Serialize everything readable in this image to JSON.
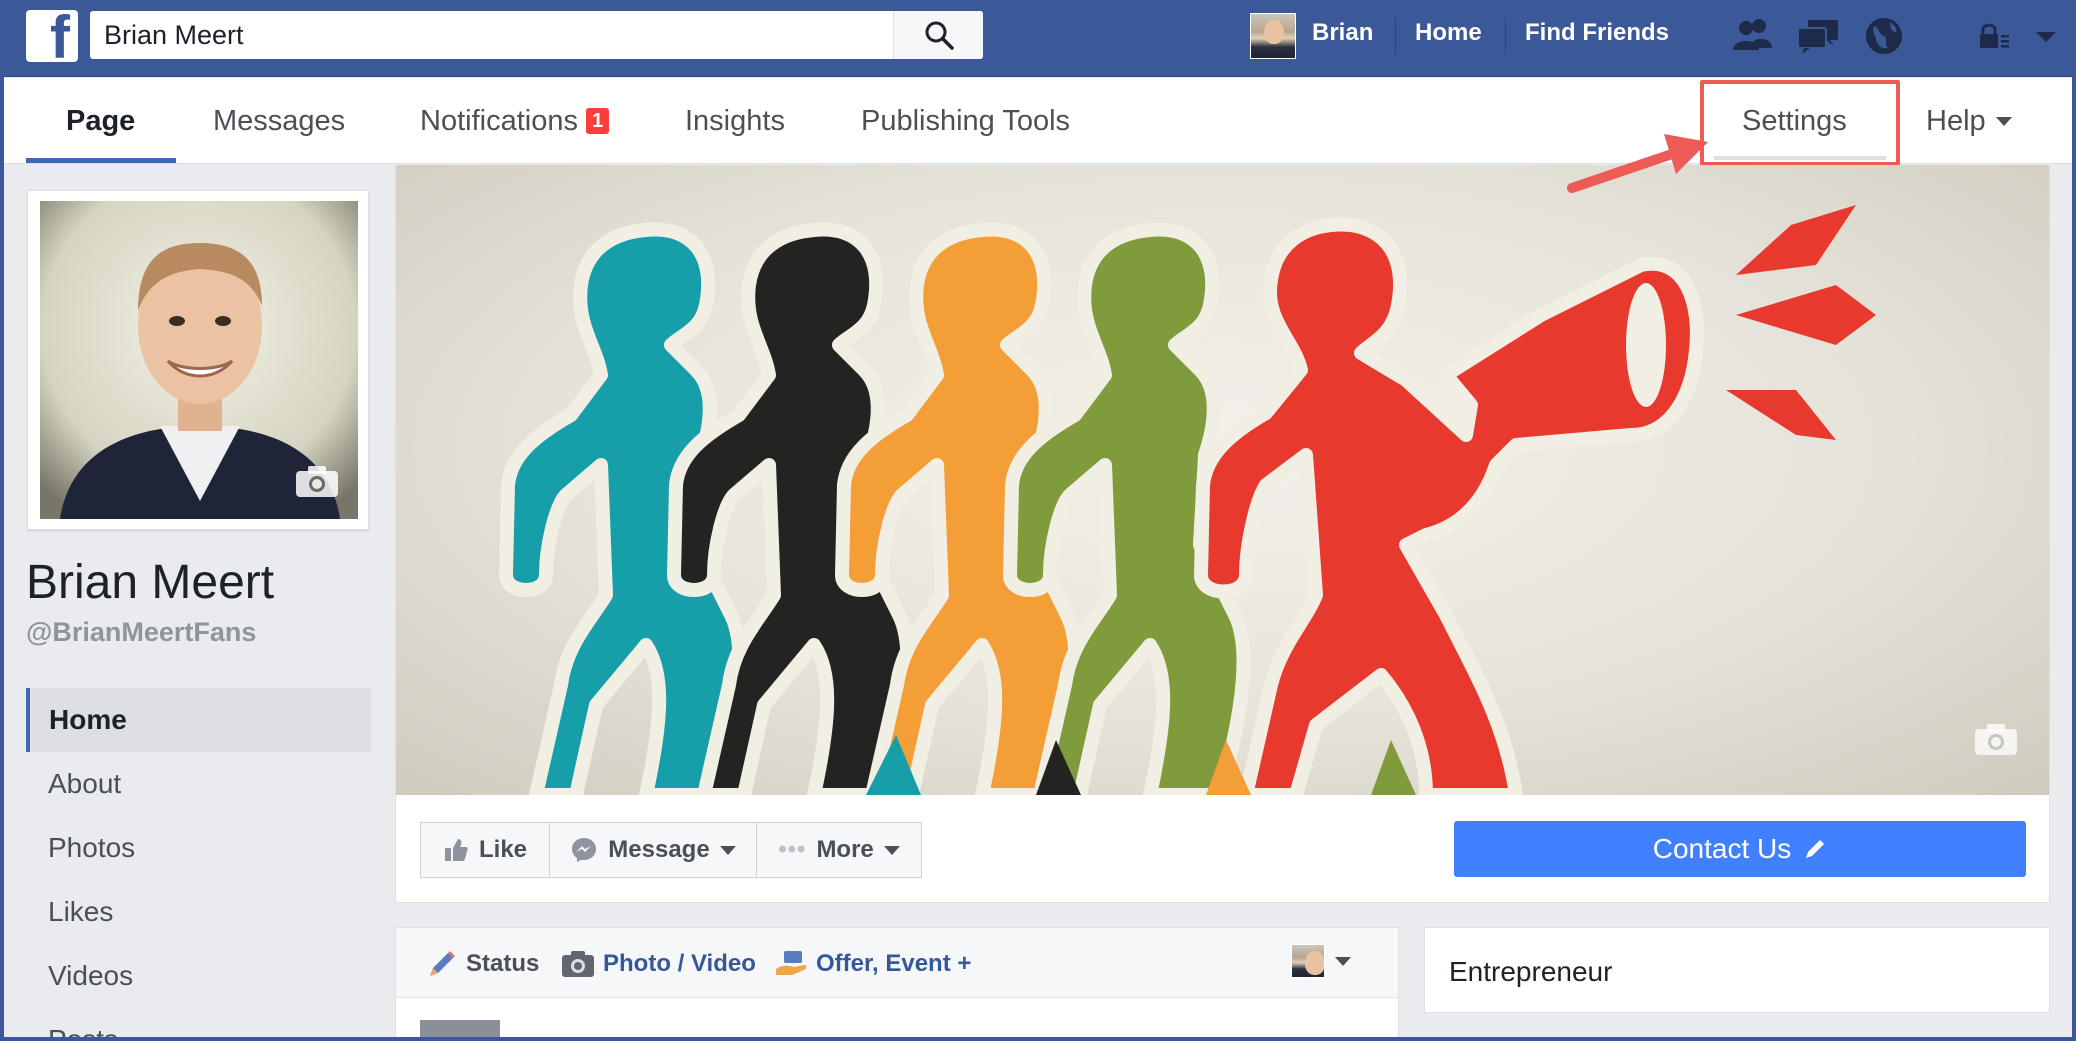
{
  "topbar": {
    "logo_letter": "f",
    "search_value": "Brian Meert",
    "user_name": "Brian",
    "home_label": "Home",
    "find_friends_label": "Find Friends"
  },
  "page_nav": {
    "tabs": [
      {
        "label": "Page"
      },
      {
        "label": "Messages"
      },
      {
        "label": "Notifications",
        "badge": "1"
      },
      {
        "label": "Insights"
      },
      {
        "label": "Publishing Tools"
      }
    ],
    "settings_label": "Settings",
    "help_label": "Help"
  },
  "profile": {
    "name": "Brian Meert",
    "handle": "@BrianMeertFans"
  },
  "side_nav": {
    "items": [
      {
        "label": "Home"
      },
      {
        "label": "About"
      },
      {
        "label": "Photos"
      },
      {
        "label": "Likes"
      },
      {
        "label": "Videos"
      },
      {
        "label": "Posts"
      }
    ]
  },
  "actions": {
    "like_label": "Like",
    "message_label": "Message",
    "more_label": "More",
    "contact_label": "Contact Us"
  },
  "composer": {
    "status_label": "Status",
    "photo_label": "Photo / Video",
    "offer_label": "Offer, Event +"
  },
  "about": {
    "category": "Entrepreneur"
  },
  "colors": {
    "facebook_blue": "#3b5998",
    "accent_blue": "#4267b2",
    "contact_button": "#4080ff",
    "highlight_red": "#ee5a55",
    "badge_red": "#fa3e3e"
  }
}
